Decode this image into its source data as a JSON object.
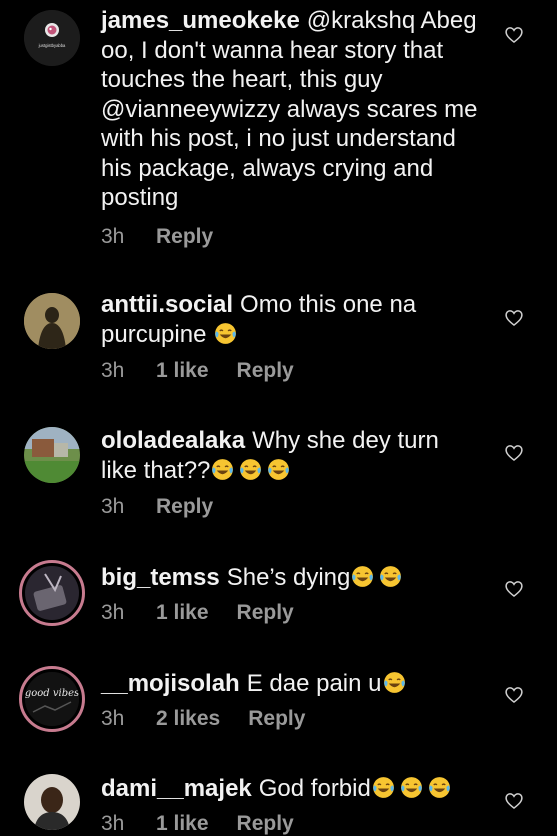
{
  "comments": [
    {
      "username": "james_umeokeke",
      "text": "@krakshq Abeg oo, I don't wanna hear story that touches the heart, this guy @vianneeywizzy always scares me with his post, i no just understand his package, always crying and posting",
      "emoji_count": 0,
      "time": "3h",
      "likes": "",
      "reply": "Reply",
      "avatar_text": "justgistbyabba"
    },
    {
      "username": "anttii.social",
      "text": "Omo this one na purcupine",
      "emoji_count": 1,
      "time": "3h",
      "likes": "1 like",
      "reply": "Reply"
    },
    {
      "username": "ololadealaka",
      "text": "Why she dey turn like that??",
      "emoji_count": 3,
      "time": "3h",
      "likes": "",
      "reply": "Reply"
    },
    {
      "username": "big_temss",
      "text": "She’s dying",
      "emoji_count": 2,
      "time": "3h",
      "likes": "1 like",
      "reply": "Reply"
    },
    {
      "username": "__mojisolah",
      "text": "E dae pain u",
      "emoji_count": 1,
      "time": "3h",
      "likes": "2 likes",
      "reply": "Reply",
      "avatar_text": "good vibes"
    },
    {
      "username": "dami__majek",
      "text": "God forbid",
      "emoji_count": 3,
      "time": "3h",
      "likes": "1 like",
      "reply": "Reply"
    }
  ],
  "icons": {
    "like": "heart-outline-icon",
    "emoji": "face-with-tears-of-joy-emoji"
  },
  "colors": {
    "background": "#000000",
    "text": "#f2f2f2",
    "meta": "#9a9a9a",
    "story_ring": "#c77b8f"
  }
}
